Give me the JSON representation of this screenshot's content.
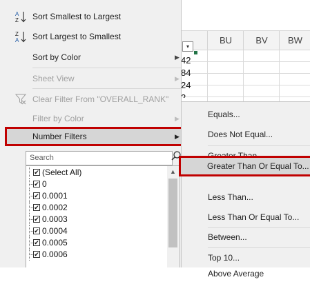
{
  "sheet": {
    "columns": [
      "BU",
      "BV",
      "BW"
    ],
    "cells": [
      "42",
      "84",
      "24",
      "2"
    ],
    "filter_dropdown_glyph": "▾"
  },
  "menu": {
    "sort_asc": "Sort Smallest to Largest",
    "sort_desc": "Sort Largest to Smallest",
    "sort_by_color": "Sort by Color",
    "sheet_view": "Sheet View",
    "clear_filter": "Clear Filter From \"OVERALL_RANK\"",
    "filter_by_color": "Filter by Color",
    "number_filters": "Number Filters",
    "search_placeholder": "Search",
    "submenu_arrow": "▶",
    "sort_asc_icon_top": "A",
    "sort_asc_icon_bottom": "Z",
    "sort_desc_icon_top": "Z",
    "sort_desc_icon_bottom": "A"
  },
  "list": {
    "items": [
      "(Select All)",
      "0",
      "0.0001",
      "0.0002",
      "0.0003",
      "0.0004",
      "0.0005",
      "0.0006"
    ],
    "check_glyph": "✔",
    "scroll_up_glyph": "▲"
  },
  "submenu": {
    "equals": "Equals...",
    "not_equal": "Does Not Equal...",
    "greater_than": "Greater Than...",
    "greater_equal": "Greater Than Or Equal To...",
    "less_than": "Less Than...",
    "less_equal": "Less Than Or Equal To...",
    "between": "Between...",
    "top10": "Top 10...",
    "above_avg": "Above Average"
  },
  "colors": {
    "highlight_border": "#c00000",
    "menu_bg": "#f0f0f0",
    "excel_green": "#217346"
  },
  "icons": {
    "sort_asc": "sort-ascending-icon",
    "sort_desc": "sort-descending-icon",
    "clear_filter": "clear-filter-icon",
    "search": "search-icon"
  }
}
